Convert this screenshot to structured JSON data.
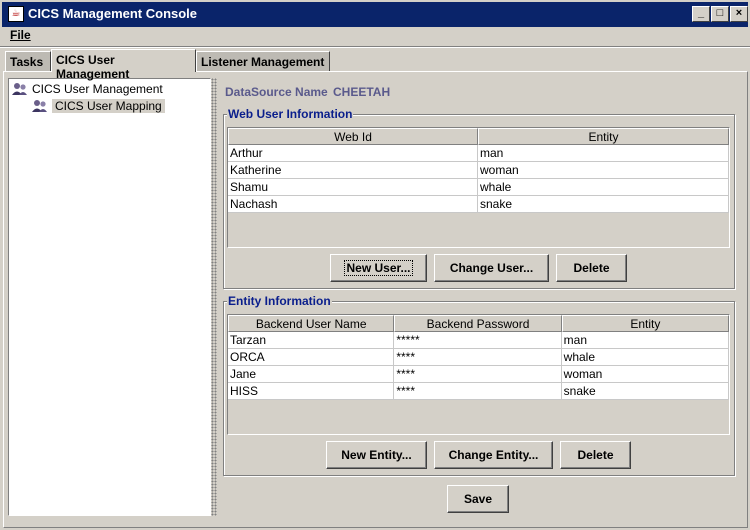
{
  "window": {
    "title": "CICS Management Console",
    "icon": "java-coffee-cup-icon",
    "controls": {
      "minimize": "_",
      "maximize": "□",
      "close": "×"
    }
  },
  "menu": {
    "file": "File"
  },
  "tabs": [
    {
      "label": "Tasks",
      "active": false
    },
    {
      "label": "CICS User Management",
      "active": true
    },
    {
      "label": "Listener Management",
      "active": false
    }
  ],
  "tree": {
    "root": {
      "label": "CICS User Management",
      "icon": "users-icon"
    },
    "child": {
      "label": "CICS User Mapping",
      "icon": "users-icon",
      "selected": true
    }
  },
  "datasource": {
    "label": "DataSource Name",
    "value": "CHEETAH"
  },
  "web_user_info": {
    "title": "Web User Information",
    "columns": [
      "Web Id",
      "Entity"
    ],
    "rows": [
      [
        "Arthur",
        "man"
      ],
      [
        "Katherine",
        "woman"
      ],
      [
        "Shamu",
        "whale"
      ],
      [
        "Nachash",
        "snake"
      ]
    ],
    "buttons": {
      "new": "New User...",
      "change": "Change User...",
      "delete": "Delete"
    }
  },
  "entity_info": {
    "title": "Entity Information",
    "columns": [
      "Backend User Name",
      "Backend Password",
      "Entity"
    ],
    "rows": [
      [
        "Tarzan",
        "*****",
        "man"
      ],
      [
        "ORCA",
        "****",
        "whale"
      ],
      [
        "Jane",
        "****",
        "woman"
      ],
      [
        "HISS",
        "****",
        "snake"
      ]
    ],
    "buttons": {
      "new": "New Entity...",
      "change": "Change Entity...",
      "delete": "Delete"
    }
  },
  "save_label": "Save",
  "colors": {
    "titlebar": "#0a246a",
    "group_title": "#0a1e8c",
    "datasource": "#5a5a8c",
    "face": "#d4d0c8"
  }
}
